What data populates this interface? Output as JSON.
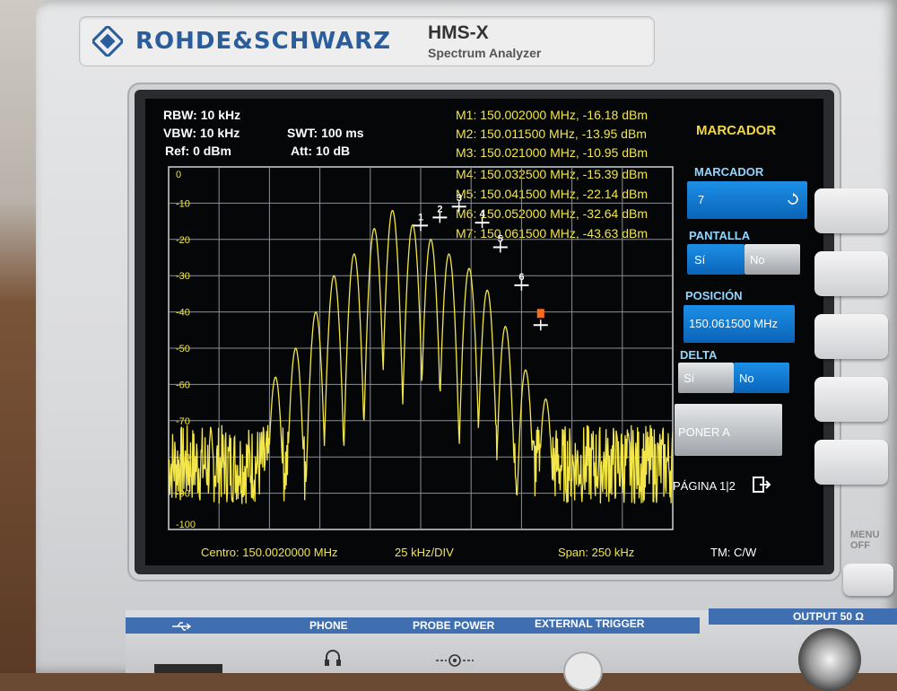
{
  "brand": {
    "name": "ROHDE&SCHWARZ",
    "model": "HMS-X",
    "subtitle": "Spectrum Analyzer"
  },
  "header": {
    "rbw": "RBW: 10 kHz",
    "vbw": "VBW: 10 kHz",
    "ref": "Ref: 0 dBm",
    "swt": "SWT: 100 ms",
    "att": "Att: 10 dB"
  },
  "markers": [
    {
      "label": "M1: 150.002000 MHz, -16.18 dBm",
      "id": "1",
      "freq_mhz": 150.002,
      "level_dbm": -16.18
    },
    {
      "label": "M2: 150.011500 MHz, -13.95 dBm",
      "id": "2",
      "freq_mhz": 150.0115,
      "level_dbm": -13.95
    },
    {
      "label": "M3: 150.021000 MHz, -10.95 dBm",
      "id": "3",
      "freq_mhz": 150.021,
      "level_dbm": -10.95
    },
    {
      "label": "M4: 150.032500 MHz, -15.39 dBm",
      "id": "4",
      "freq_mhz": 150.0325,
      "level_dbm": -15.39
    },
    {
      "label": "M5: 150.041500 MHz, -22.14 dBm",
      "id": "5",
      "freq_mhz": 150.0415,
      "level_dbm": -22.14
    },
    {
      "label": "M6: 150.052000 MHz, -32.64 dBm",
      "id": "6",
      "freq_mhz": 150.052,
      "level_dbm": -32.64
    },
    {
      "label": "M7: 150.061500 MHz, -43.63 dBm",
      "id": "7",
      "freq_mhz": 150.0615,
      "level_dbm": -43.63
    }
  ],
  "footer": {
    "center": "Centro: 150.0020000 MHz",
    "div": "25 kHz/DIV",
    "span": "Span: 250 kHz",
    "tm": "TM: C/W"
  },
  "menu": {
    "title": "MARCADOR",
    "marker_label": "MARCADOR",
    "marker_value": "7",
    "pantalla_label": "PANTALLA",
    "si": "Sí",
    "no": "No",
    "posicion_label": "POSICIÓN",
    "posicion_value": "150.061500 MHz",
    "delta_label": "DELTA",
    "poner": "PONER A",
    "pagina": "PÁGINA 1|2"
  },
  "panel": {
    "phone": "PHONE",
    "probe": "PROBE POWER",
    "trigger": "EXTERNAL TRIGGER",
    "output": "OUTPUT 50 Ω",
    "menu_off": "MENU OFF"
  },
  "colors": {
    "trace": "#f2e64a",
    "grid": "#8a8f96",
    "accent": "#1c8fe6",
    "brand": "#2a5d9c"
  },
  "chart_data": {
    "type": "line",
    "title": "",
    "xlabel": "",
    "ylabel": "",
    "x_center_mhz": 150.002,
    "x_span_khz": 250,
    "xlim_khz": [
      -125,
      125
    ],
    "ylim": [
      -100,
      0
    ],
    "y_ticks": [
      "0",
      "-10",
      "-20",
      "-30",
      "-40",
      "-50",
      "-60",
      "-70",
      "-80",
      "-90",
      "-100"
    ],
    "grid": true,
    "series": [
      {
        "peaks_offset_khz": [
          -72,
          -62,
          -52,
          -43,
          -33,
          -23,
          -14,
          -4,
          5,
          14,
          24,
          33,
          42,
          52,
          62
        ],
        "peaks_dbm": [
          -58,
          -50,
          -40,
          -30,
          -24,
          -17,
          -12,
          -16,
          -20,
          -24,
          -28,
          -34,
          -44,
          -56,
          -64
        ],
        "noise_floor_dbm": -82
      }
    ]
  }
}
